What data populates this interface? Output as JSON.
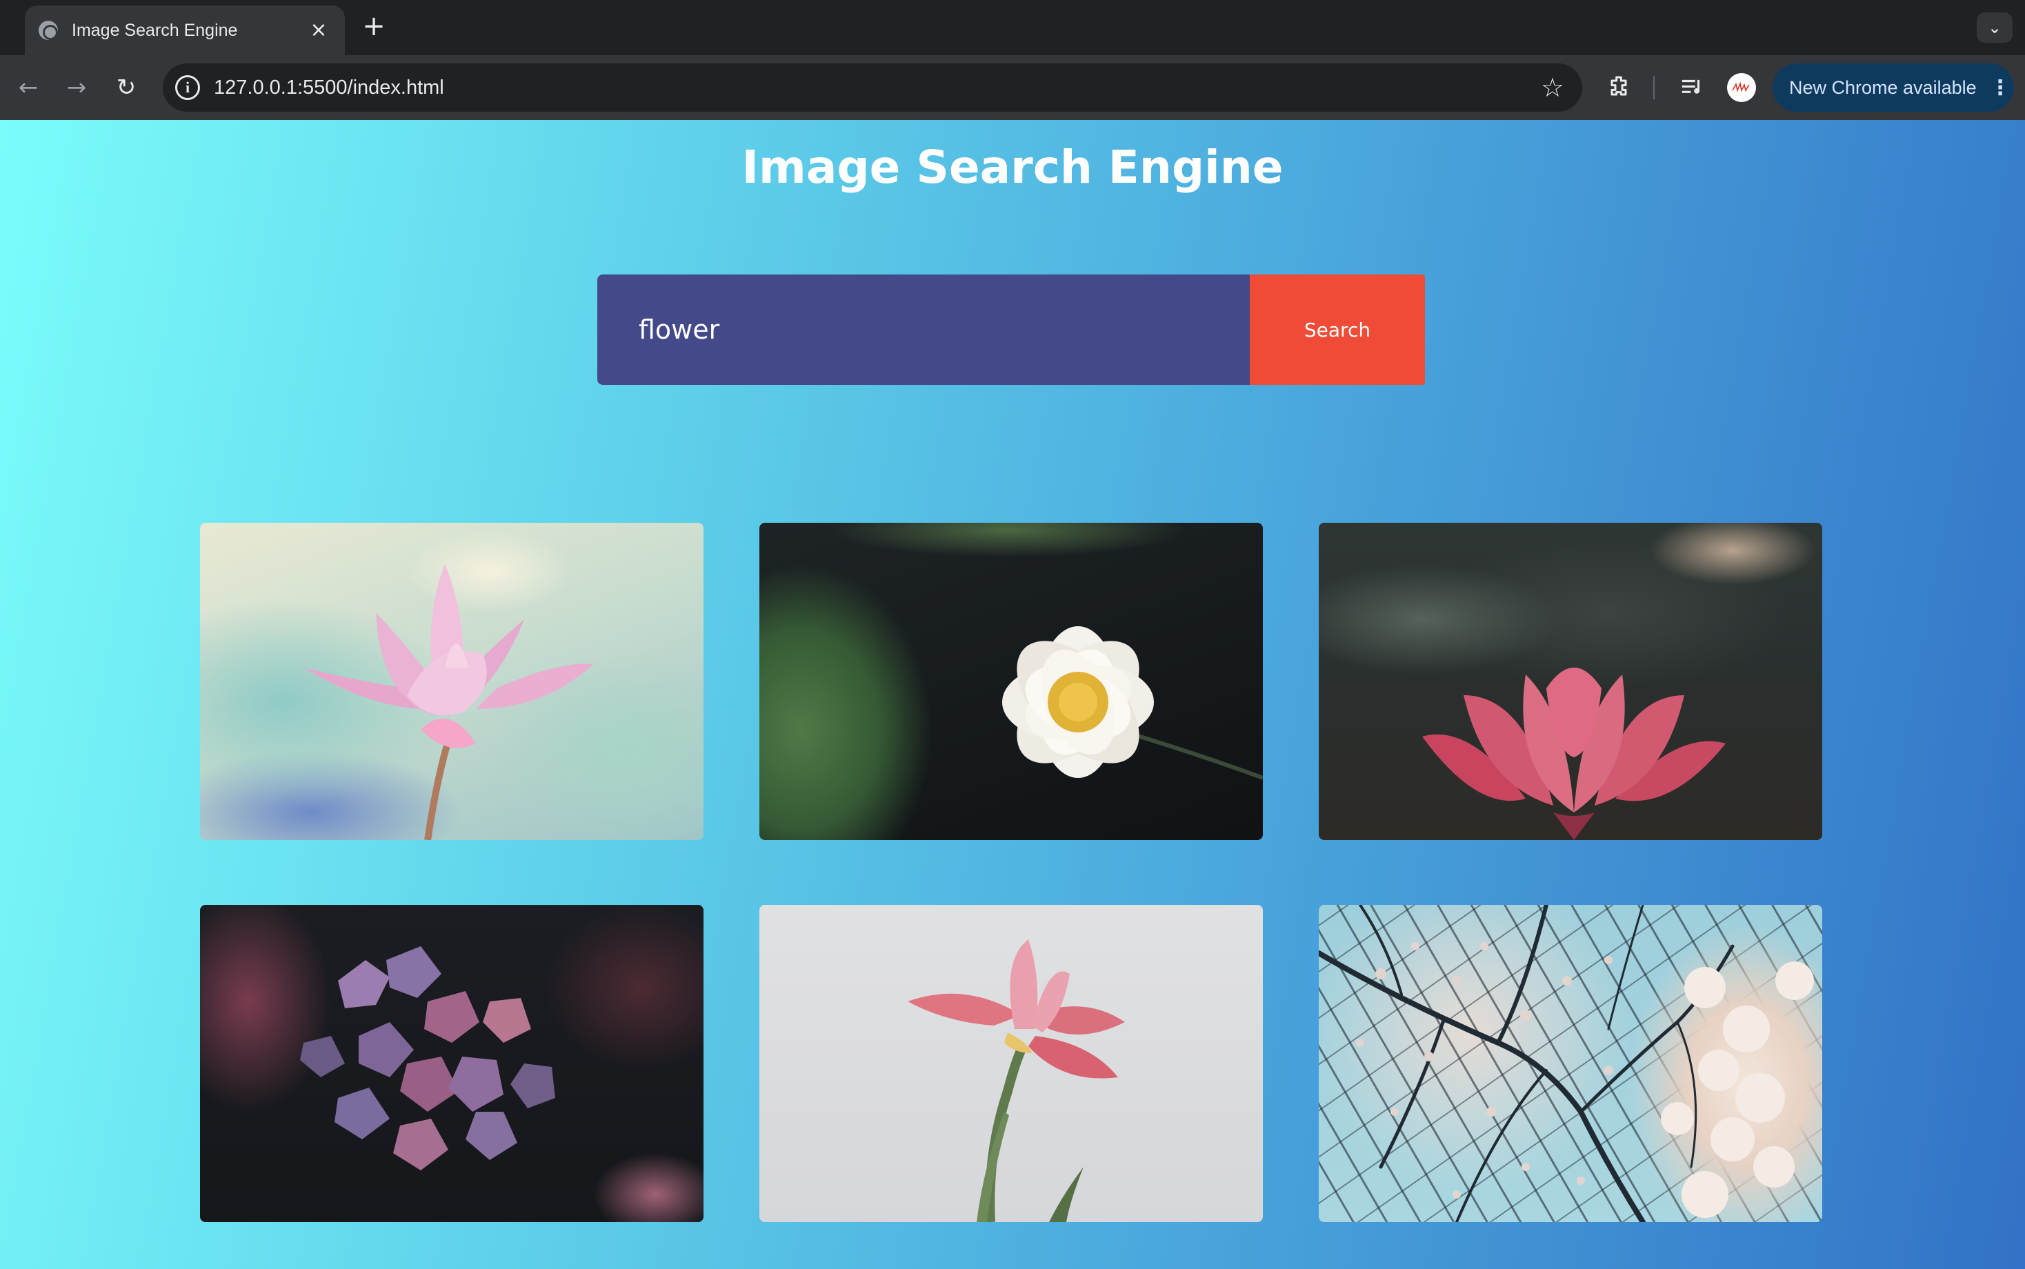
{
  "browser": {
    "tab": {
      "title": "Image Search Engine",
      "close_icon": "×"
    },
    "new_tab_icon": "+",
    "tab_search_icon": "⌄",
    "nav": {
      "back_icon": "←",
      "forward_icon": "→",
      "reload_icon": "↻"
    },
    "address_bar": {
      "url": "127.0.0.1:5500/index.html",
      "info_icon": "i",
      "bookmark_icon": "☆"
    },
    "extensions_icon": "⧉",
    "media_icon": "≡",
    "update_button": {
      "label": "New Chrome available",
      "menu_icon": "⋮"
    }
  },
  "page": {
    "title": "Image Search Engine",
    "search": {
      "value": "flower",
      "button_label": "Search"
    },
    "results": [
      {
        "name": "pink-lotus"
      },
      {
        "name": "white-water-lily"
      },
      {
        "name": "red-lotus"
      },
      {
        "name": "purple-hydrangea"
      },
      {
        "name": "pink-iris"
      },
      {
        "name": "cherry-blossom-branches"
      }
    ]
  },
  "colors": {
    "gradient_start": "#7bfcfb",
    "gradient_end": "#3272c6",
    "search_input_bg": "#434989",
    "search_button_bg": "#ef4b36",
    "chrome_dark": "#202124",
    "chrome_toolbar": "#35363a"
  }
}
